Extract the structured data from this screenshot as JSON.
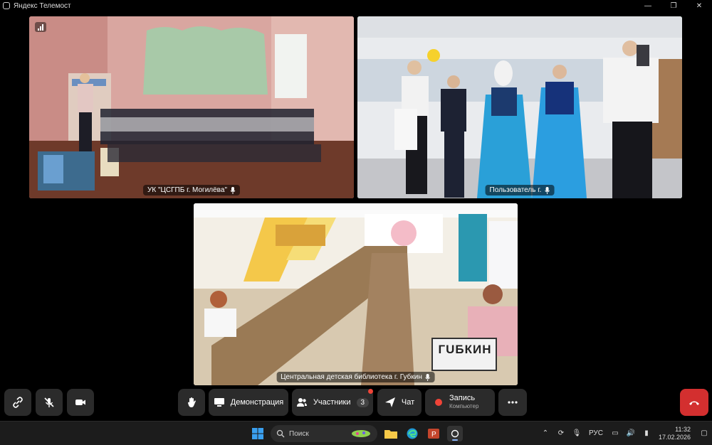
{
  "window": {
    "title": "Яндекс Телемост",
    "controls": [
      "—",
      "❐",
      "✕"
    ]
  },
  "tiles": [
    {
      "name": "УК \"ЦСГПБ г. Могилёва\"",
      "mic": "mic-icon"
    },
    {
      "name": "Пользователь г.",
      "mic": "mic-icon",
      "active_speaker": true
    },
    {
      "name": "Центральная детская библиотека г. Губкин",
      "mic": "mic-icon",
      "sign_text": "ГUБКИН"
    }
  ],
  "toolbar": {
    "demo_label": "Демонстрация",
    "participants_label": "Участники",
    "participants_count": "3",
    "chat_label": "Чат",
    "record_label": "Запись",
    "record_sub": "Компьютер"
  },
  "taskbar": {
    "search_placeholder": "Поиск",
    "lang": "РУС",
    "time": "11:32",
    "date": "17.02.2026"
  },
  "colors": {
    "active_outline": "#3ee07a",
    "end_call": "#d32f2f",
    "record": "#f04438"
  }
}
